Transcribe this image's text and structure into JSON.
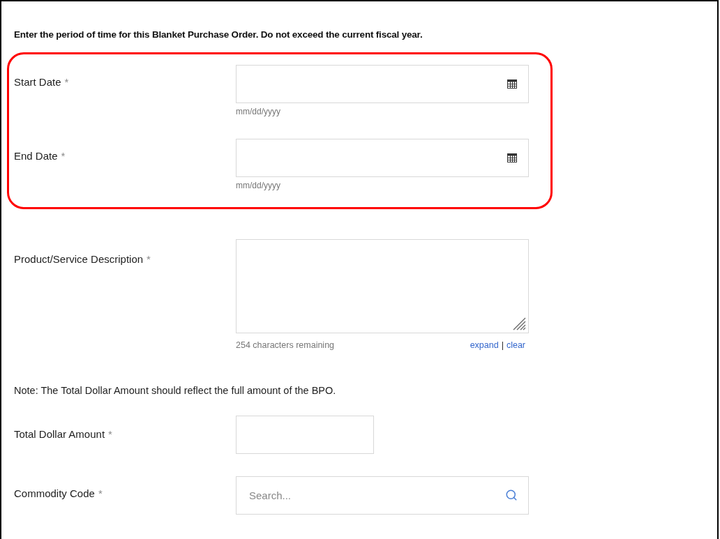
{
  "instructions": "Enter the period of time for this Blanket Purchase Order. Do not exceed the current fiscal year.",
  "date_section": {
    "highlighted": true,
    "fields": [
      {
        "kind": "date",
        "label": "Start Date",
        "required_mark": "*",
        "hint": "mm/dd/yyyy"
      },
      {
        "kind": "date",
        "label": "End Date",
        "required_mark": "*",
        "hint": "mm/dd/yyyy"
      }
    ]
  },
  "description": {
    "kind": "textarea",
    "label": "Product/Service Description",
    "required_mark": "*",
    "counter": "254 characters remaining",
    "links": [
      "expand",
      "clear"
    ],
    "separator": "|"
  },
  "note": "Note: The Total Dollar Amount should reflect the full amount of the BPO.",
  "fields": [
    {
      "kind": "text",
      "label": "Total Dollar Amount",
      "required_mark": "*"
    },
    {
      "kind": "search",
      "label": "Commodity Code",
      "required_mark": "*",
      "placeholder": "Search..."
    }
  ]
}
